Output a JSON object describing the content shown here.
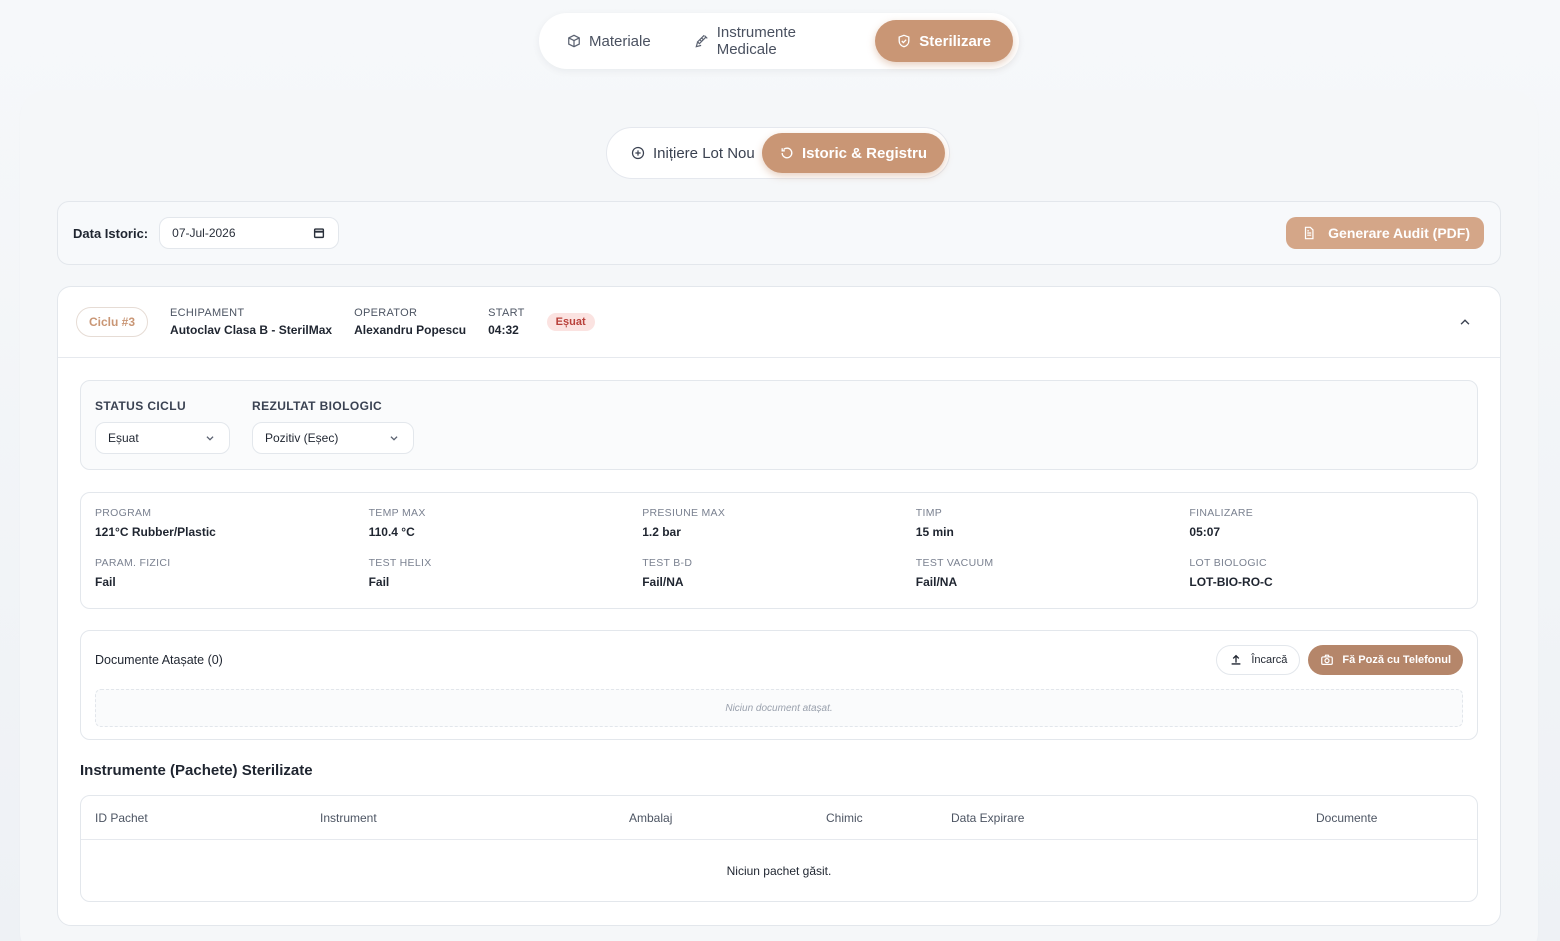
{
  "topnav": {
    "tabs": [
      {
        "label": "Materiale",
        "icon": "box-icon"
      },
      {
        "label": "Instrumente Medicale",
        "icon": "syringe-icon"
      },
      {
        "label": "Sterilizare",
        "icon": "shield-icon",
        "active": true
      }
    ]
  },
  "subnav": {
    "tabs": [
      {
        "label": "Inițiere Lot Nou",
        "icon": "plus-circle-icon"
      },
      {
        "label": "Istoric & Registru",
        "icon": "history-icon",
        "active": true
      }
    ]
  },
  "filter": {
    "label": "Data Istoric:",
    "date_value": "07-Jul-2026",
    "audit_button": "Generare Audit (PDF)"
  },
  "cycle": {
    "tag": "Ciclu #3",
    "equipment_label": "ECHIPAMENT",
    "equipment_value": "Autoclav Clasa B - SterilMax",
    "operator_label": "OPERATOR",
    "operator_value": "Alexandru Popescu",
    "start_label": "START",
    "start_value": "04:32",
    "status_badge": "Eșuat",
    "status_field_label": "STATUS CICLU",
    "status_field_value": "Eșuat",
    "bio_field_label": "REZULTAT BIOLOGIC",
    "bio_field_value": "Pozitiv (Eșec)",
    "params": [
      {
        "k": "PROGRAM",
        "v": "121°C Rubber/Plastic"
      },
      {
        "k": "TEMP MAX",
        "v": "110.4 °C"
      },
      {
        "k": "PRESIUNE MAX",
        "v": "1.2 bar"
      },
      {
        "k": "TIMP",
        "v": "15 min"
      },
      {
        "k": "FINALIZARE",
        "v": "05:07"
      },
      {
        "k": "PARAM. FIZICI",
        "v": "Fail"
      },
      {
        "k": "TEST HELIX",
        "v": "Fail"
      },
      {
        "k": "TEST B-D",
        "v": "Fail/NA"
      },
      {
        "k": "TEST VACUUM",
        "v": "Fail/NA"
      },
      {
        "k": "LOT BIOLOGIC",
        "v": "LOT-BIO-RO-C"
      }
    ],
    "docs": {
      "title": "Documente Atașate (0)",
      "upload_label": "Încarcă",
      "photo_label": "Fă Poză cu Telefonul",
      "empty_text": "Niciun document atașat."
    },
    "instruments": {
      "title": "Instrumente (Pachete) Sterilizate",
      "columns": [
        "ID Pachet",
        "Instrument",
        "Ambalaj",
        "Chimic",
        "Data Expirare",
        "Documente"
      ],
      "empty_text": "Niciun pachet găsit."
    }
  },
  "colors": {
    "accent": "#c99675",
    "danger_bg": "#fbe3e1",
    "danger_text": "#b8403a"
  }
}
